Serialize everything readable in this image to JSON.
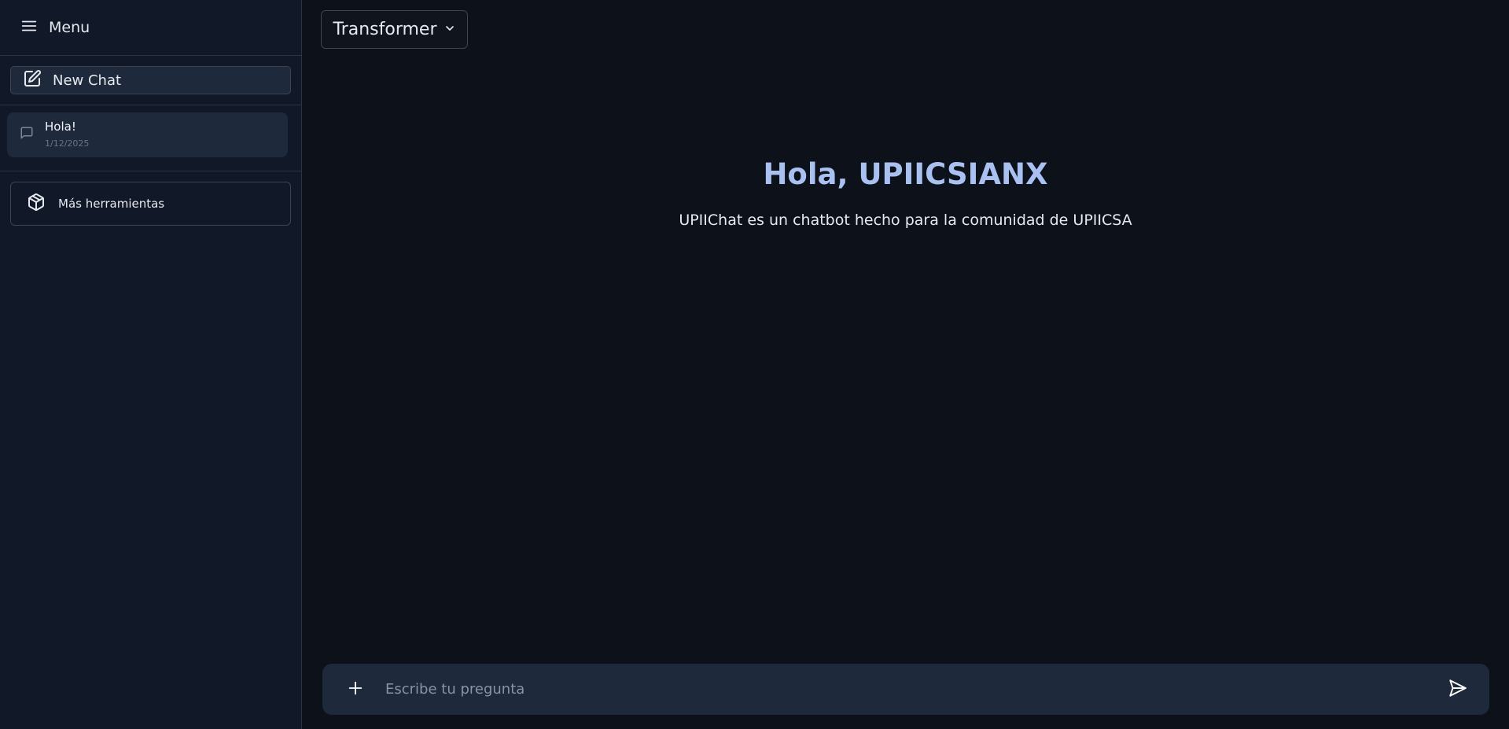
{
  "sidebar": {
    "menu_label": "Menu",
    "new_chat_label": "New Chat",
    "chats": [
      {
        "title": "Hola!",
        "date": "1/12/2025"
      }
    ],
    "tools_label": "Más herramientas"
  },
  "header": {
    "model_selected": "Transformer"
  },
  "main": {
    "greeting": "Hola, UPIICSIANX",
    "subtitle": "UPIIChat es un chatbot hecho para la comunidad de UPIICSA"
  },
  "composer": {
    "placeholder": "Escribe tu pregunta",
    "value": ""
  },
  "icons": {
    "menu": "hamburger-icon",
    "new_chat": "edit-icon",
    "chat": "message-icon",
    "tools": "package-icon",
    "dropdown": "chevron-down-icon",
    "attach": "plus-icon",
    "send": "send-icon"
  },
  "colors": {
    "background": "#0d111a",
    "sidebar": "#111827",
    "panel": "#1e293b",
    "accent": "#a9c1f0"
  }
}
